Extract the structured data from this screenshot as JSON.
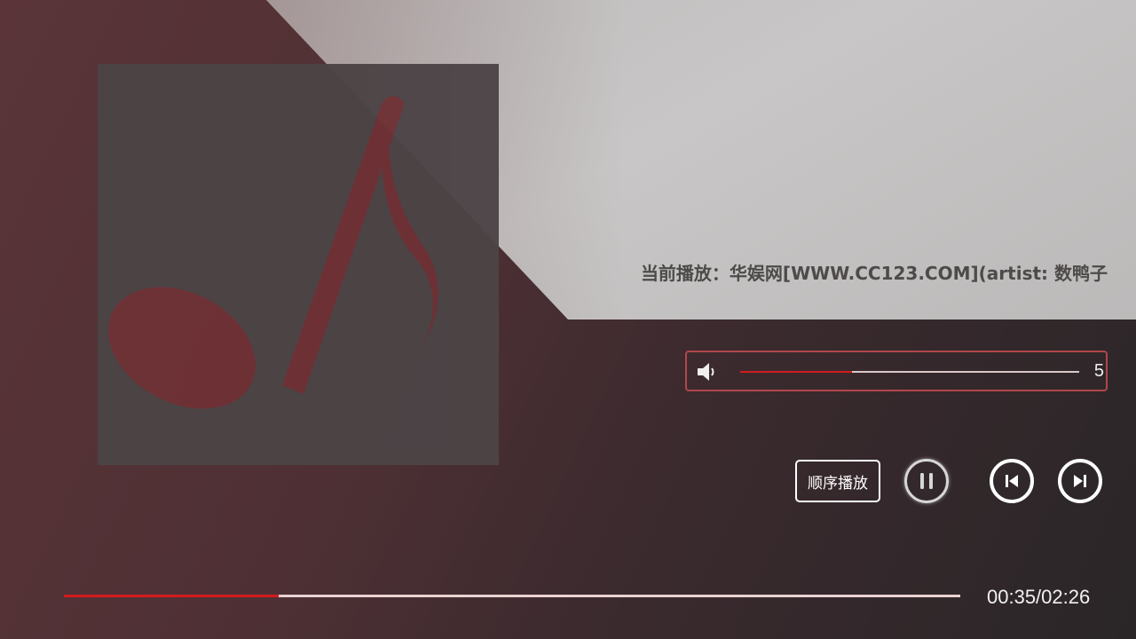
{
  "now_playing": {
    "text": "当前播放：华娱网[WWW.CC123.COM](artist: 数鸭子"
  },
  "album_art": {
    "icon": "music-note-icon"
  },
  "volume": {
    "icon": "speaker-icon",
    "level_fraction": 0.33,
    "value": "5"
  },
  "controls": {
    "mode_label": "顺序播放",
    "pause_icon": "pause-icon",
    "previous_icon": "skip-previous-icon",
    "next_icon": "skip-next-icon"
  },
  "progress": {
    "fraction": 0.24,
    "time_text": "00:35/02:26"
  },
  "colors": {
    "accent": "#d21b1f",
    "panel_border": "#b0474b",
    "note": "#6e3236"
  }
}
